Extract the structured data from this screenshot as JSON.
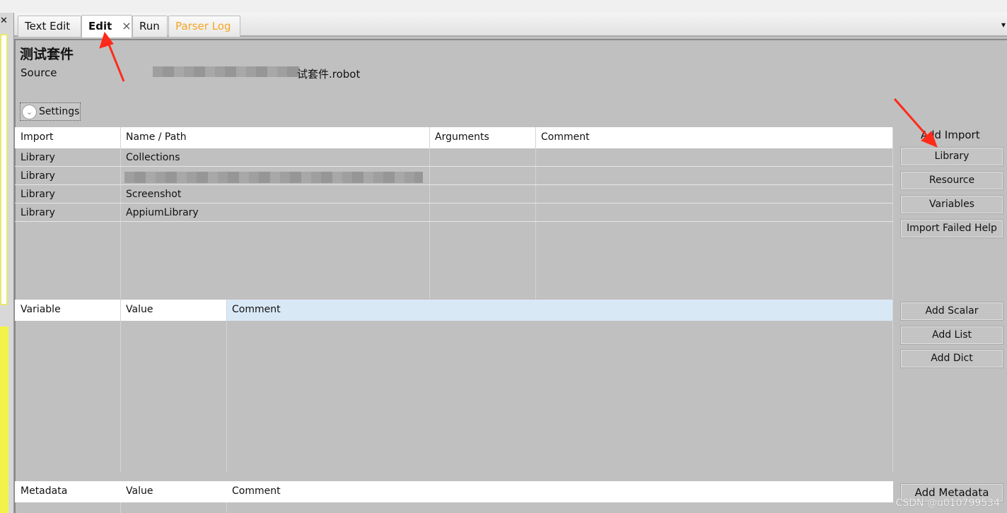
{
  "tabs": [
    {
      "label": "Text Edit"
    },
    {
      "label": "Edit",
      "close": "×"
    },
    {
      "label": "Run"
    },
    {
      "label": "Parser Log",
      "color": "#f5a623"
    }
  ],
  "tab_menu_icon": "▾",
  "suite": {
    "title": "测试套件",
    "source_label": "Source",
    "source_value": "试套件.robot"
  },
  "settings": {
    "label": "Settings",
    "icon": "chevron-down"
  },
  "imports": {
    "columns": [
      "Import",
      "Name / Path",
      "Arguments",
      "Comment"
    ],
    "rows": [
      {
        "type": "Library",
        "name": "Collections"
      },
      {
        "type": "Library",
        "name": ""
      },
      {
        "type": "Library",
        "name": "Screenshot"
      },
      {
        "type": "Library",
        "name": "AppiumLibrary"
      }
    ],
    "side_label": "Add Import",
    "buttons": [
      "Library",
      "Resource",
      "Variables",
      "Import Failed Help"
    ]
  },
  "variables": {
    "columns": [
      "Variable",
      "Value",
      "Comment"
    ],
    "buttons": [
      "Add Scalar",
      "Add List",
      "Add Dict"
    ]
  },
  "metadata": {
    "columns": [
      "Metadata",
      "Value",
      "Comment"
    ],
    "buttons": [
      "Add Metadata"
    ]
  },
  "watermark": "CSDN @u010799534",
  "colors": {
    "panel": "#c0c0c0",
    "selected_header": "#d9e8f5",
    "arrow": "#ff2a1a",
    "parser_log": "#f5a623"
  }
}
